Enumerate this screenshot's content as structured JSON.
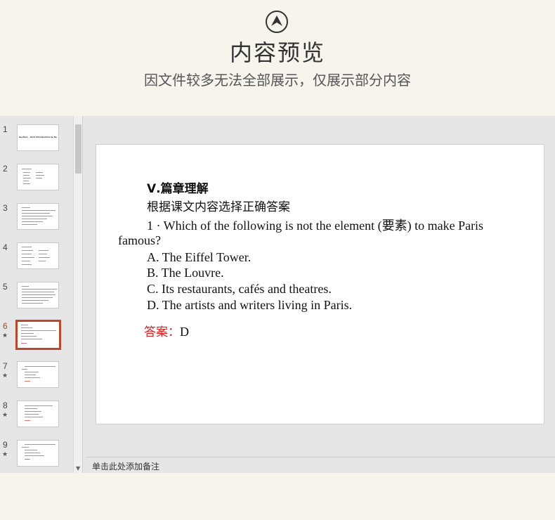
{
  "header": {
    "title": "内容预览",
    "subtitle": "因文件较多无法全部展示，仅展示部分内容",
    "logo_icon": "chevron-up-circle-icon"
  },
  "colors": {
    "background": "#f7f4ee",
    "panel": "#e6e6e6",
    "active_thumbnail_border": "#b8492f",
    "answer_red": "#e02020"
  },
  "thumbnails": [
    {
      "number": "1",
      "starred": false
    },
    {
      "number": "2",
      "starred": false
    },
    {
      "number": "3",
      "starred": false
    },
    {
      "number": "4",
      "starred": false
    },
    {
      "number": "5",
      "starred": false
    },
    {
      "number": "6",
      "starred": true,
      "active": true
    },
    {
      "number": "7",
      "starred": true
    },
    {
      "number": "8",
      "starred": true
    },
    {
      "number": "9",
      "starred": true
    }
  ],
  "thumbnail_star": "★",
  "thumbnail_1_title": "Section · Unit Introduction & Reading",
  "slide": {
    "heading": "Ⅴ.篇章理解",
    "instruction": "根据课文内容选择正确答案",
    "question_line1": "1 · Which of the following is not the element (要素) to make Paris",
    "question_line2": "famous?",
    "options": [
      "A. The Eiffel Tower.",
      "B. The Louvre.",
      "C. Its restaurants, cafés and theatres.",
      "D. The artists and writers living in Paris."
    ],
    "answer_label": "答案：",
    "answer_value": "D"
  },
  "notes": {
    "placeholder": "单击此处添加备注"
  }
}
